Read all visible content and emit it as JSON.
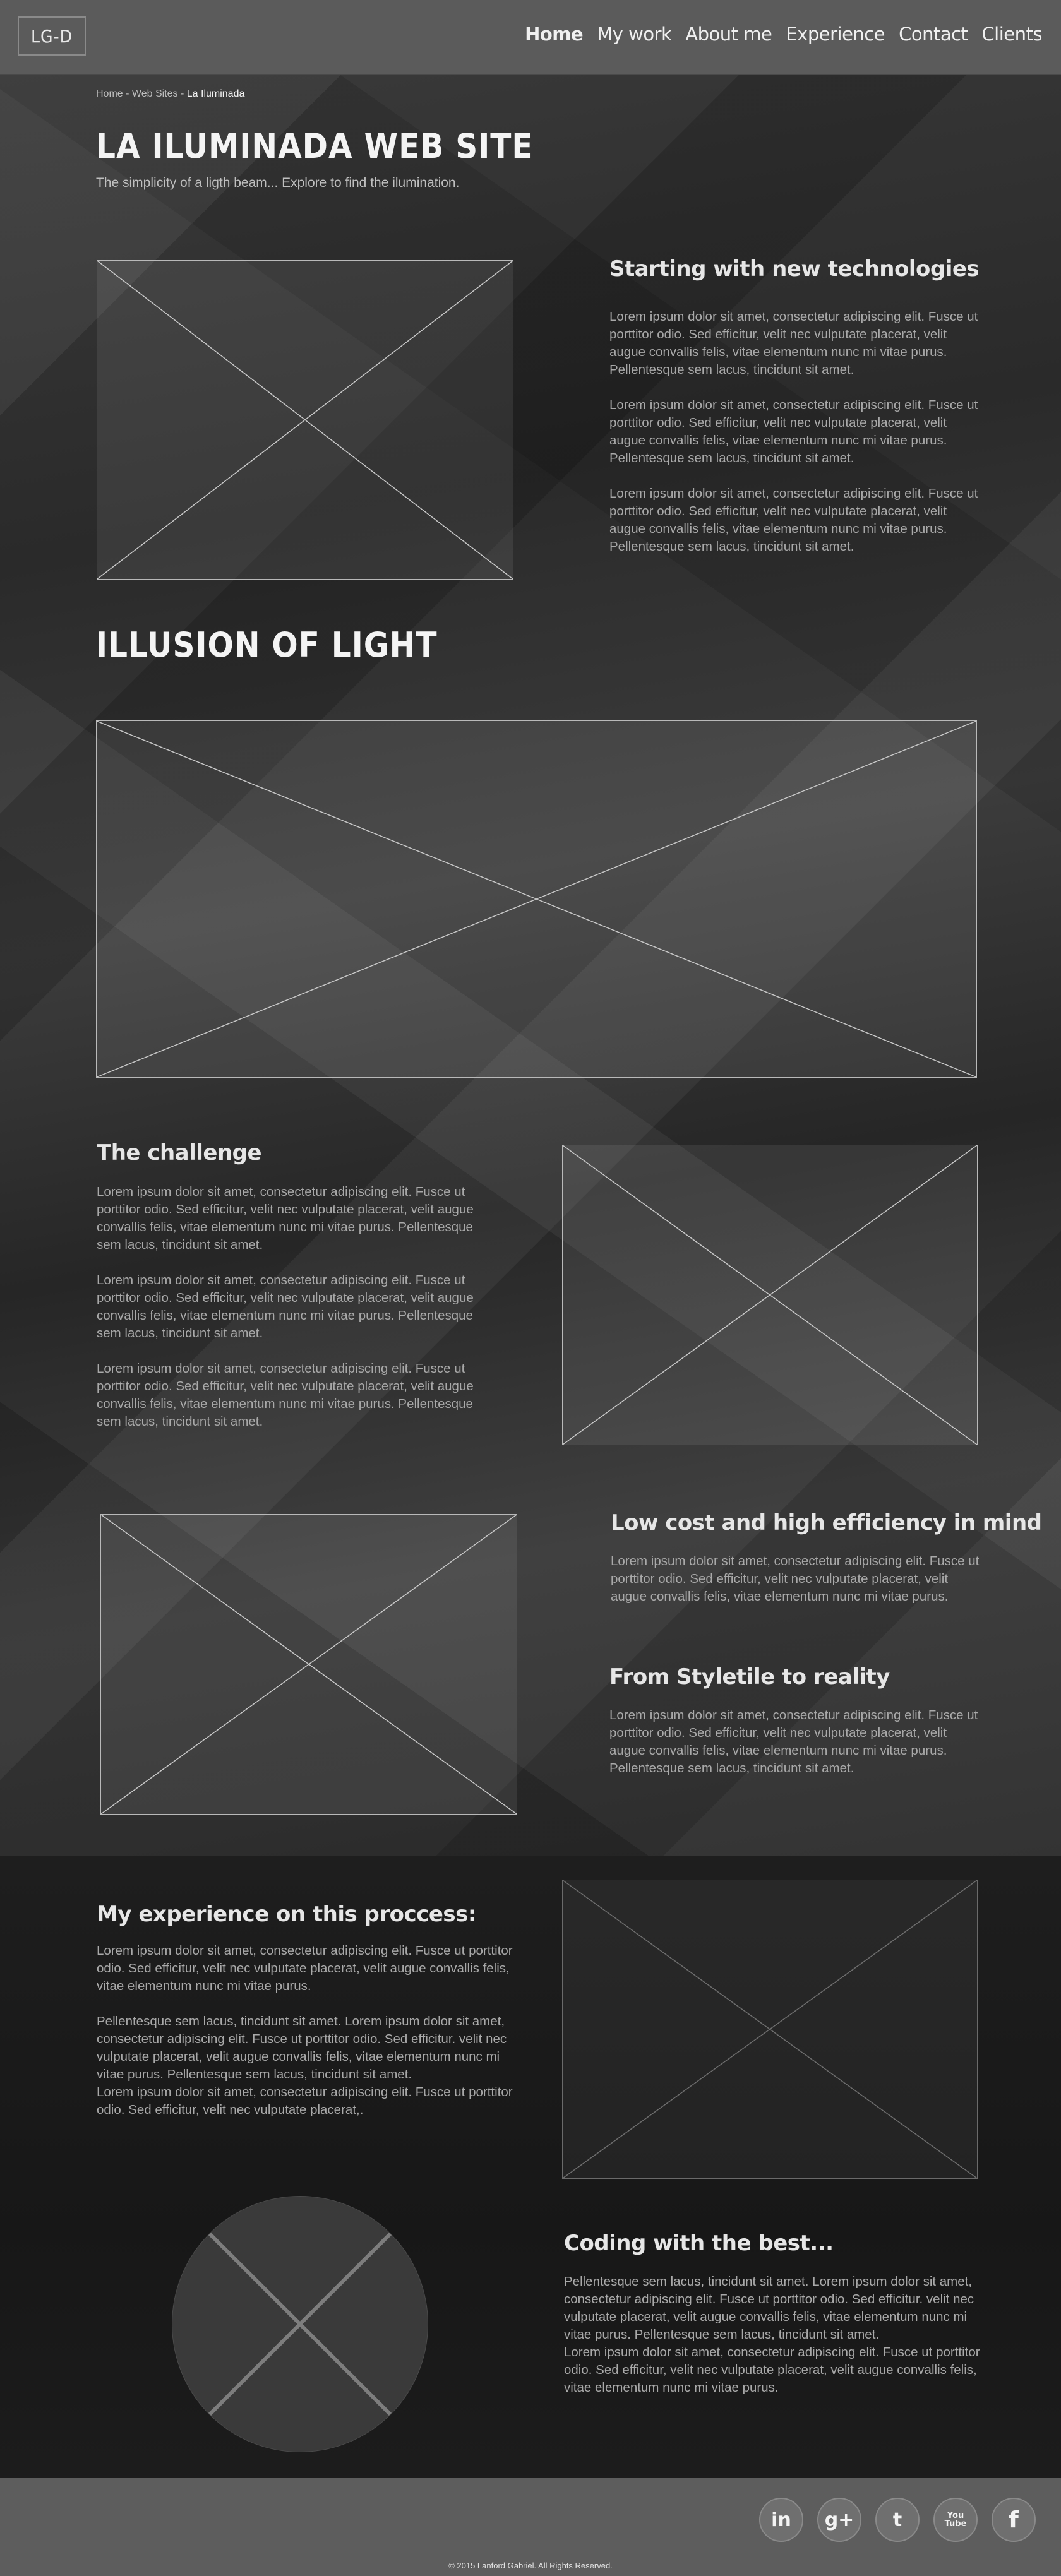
{
  "header": {
    "logo": "LG-D",
    "nav": [
      {
        "label": "Home"
      },
      {
        "label": "My work"
      },
      {
        "label": "About me"
      },
      {
        "label": "Experience"
      },
      {
        "label": "Contact"
      },
      {
        "label": "Clients"
      }
    ]
  },
  "breadcrumb": {
    "home": "Home",
    "sep1": " - ",
    "web_sites": "Web Sites",
    "sep2": " - ",
    "current": "La Iluminada"
  },
  "hero": {
    "title": "LA ILUMINADA WEB SITE",
    "subtitle": "The simplicity of a ligth beam... Explore to find the ilumination."
  },
  "intro": {
    "heading": "Starting with new technologies",
    "paragraphs": [
      "Lorem ipsum dolor sit amet, consectetur adipiscing elit. Fusce ut porttitor odio. Sed efficitur, velit nec vulputate placerat, velit augue convallis felis, vitae elementum nunc mi vitae purus. Pellentesque sem lacus, tincidunt sit amet.",
      "Lorem ipsum dolor sit amet, consectetur adipiscing elit. Fusce ut porttitor odio. Sed efficitur, velit nec vulputate placerat, velit augue convallis felis, vitae elementum nunc mi vitae purus. Pellentesque sem lacus, tincidunt sit amet.",
      "Lorem ipsum dolor sit amet, consectetur adipiscing elit. Fusce ut porttitor odio. Sed efficitur, velit nec vulputate placerat, velit augue convallis felis, vitae elementum nunc mi vitae purus. Pellentesque sem lacus, tincidunt sit amet."
    ]
  },
  "illusion": {
    "title": "ILLUSION OF LIGHT"
  },
  "challenge": {
    "heading": "The challenge",
    "paragraphs": [
      "Lorem ipsum dolor sit amet, consectetur adipiscing elit. Fusce ut porttitor odio. Sed efficitur, velit nec vulputate placerat, velit augue convallis felis, vitae elementum nunc mi vitae purus. Pellentesque sem lacus, tincidunt sit amet.",
      "Lorem ipsum dolor sit amet, consectetur adipiscing elit. Fusce ut porttitor odio. Sed efficitur, velit nec vulputate placerat, velit augue convallis felis, vitae elementum nunc mi vitae purus. Pellentesque sem lacus, tincidunt sit amet.",
      "Lorem ipsum dolor sit amet, consectetur adipiscing elit. Fusce ut porttitor odio. Sed efficitur, velit nec vulputate placerat, velit augue convallis felis, vitae elementum nunc mi vitae purus. Pellentesque sem lacus, tincidunt sit amet."
    ]
  },
  "low_cost": {
    "heading": "Low cost and high efficiency in mind",
    "paragraph": "Lorem ipsum dolor sit amet, consectetur adipiscing elit. Fusce ut porttitor odio. Sed efficitur, velit nec vulputate placerat, velit augue convallis felis, vitae elementum nunc mi vitae purus."
  },
  "styletile": {
    "heading": "From Styletile to reality",
    "paragraph": "Lorem ipsum dolor sit amet, consectetur adipiscing elit. Fusce ut porttitor odio. Sed efficitur, velit nec vulputate placerat, velit augue convallis felis, vitae elementum nunc mi vitae purus. Pellentesque sem lacus, tincidunt sit amet."
  },
  "experience": {
    "heading": "My experience on this proccess:",
    "paragraphs": [
      "Lorem ipsum dolor sit amet, consectetur adipiscing elit. Fusce ut porttitor odio. Sed efficitur, velit nec vulputate placerat, velit augue convallis felis, vitae elementum nunc mi vitae purus.",
      "Pellentesque sem lacus, tincidunt sit amet. Lorem ipsum dolor sit amet, consectetur adipiscing elit. Fusce ut porttitor odio. Sed efficitur. velit nec vulputate placerat, velit augue convallis felis, vitae elementum nunc mi vitae purus. Pellentesque sem lacus, tincidunt sit amet.",
      "Lorem ipsum dolor sit amet, consectetur adipiscing elit. Fusce ut porttitor odio. Sed efficitur, velit nec vulputate placerat,."
    ]
  },
  "coding": {
    "heading": "Coding with the best...",
    "paragraphs": [
      "Pellentesque sem lacus, tincidunt sit amet. Lorem ipsum dolor sit amet, consectetur adipiscing elit. Fusce ut porttitor odio. Sed efficitur. velit nec vulputate placerat, velit augue convallis felis, vitae elementum nunc mi vitae purus. Pellentesque sem lacus, tincidunt sit amet.",
      "Lorem ipsum dolor sit amet, consectetur adipiscing elit. Fusce ut porttitor odio. Sed efficitur, velit nec vulputate placerat, velit augue convallis felis, vitae elementum nunc mi vitae purus."
    ]
  },
  "footer": {
    "social": [
      {
        "name": "linkedin-icon",
        "glyph": "in"
      },
      {
        "name": "google-plus-icon",
        "glyph": "g+"
      },
      {
        "name": "twitter-icon",
        "glyph": "t"
      },
      {
        "name": "youtube-icon",
        "glyph": "You Tube"
      },
      {
        "name": "facebook-icon",
        "glyph": "f"
      }
    ],
    "copyright": "© 2015 Lanford Gabriel. All Rights Reserved."
  }
}
